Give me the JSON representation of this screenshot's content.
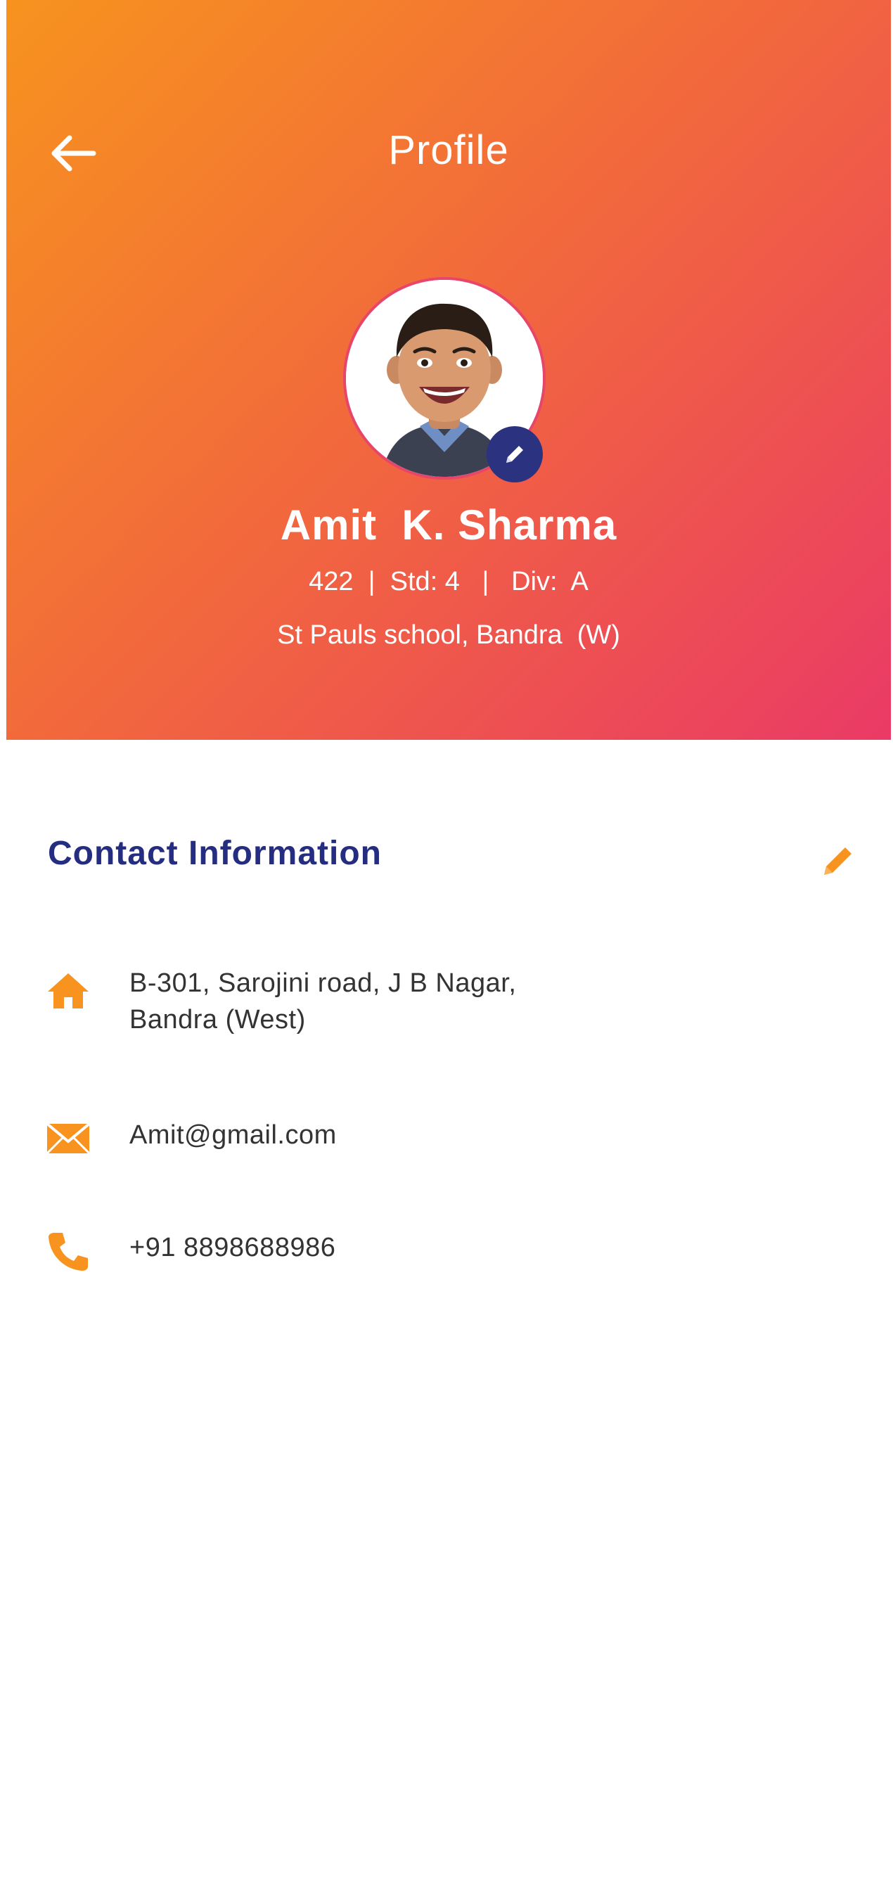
{
  "header": {
    "title": "Profile"
  },
  "profile": {
    "name": "Amit  K. Sharma",
    "meta": "422  |  Std: 4   |   Div:  A",
    "school": "St Pauls school, Bandra  (W)"
  },
  "contact": {
    "section_title": "Contact Information",
    "address_line1": "B-301, Sarojini road, J B Nagar,",
    "address_line2": "Bandra (West)",
    "email": "Amit@gmail.com",
    "phone": "+91 8898688986"
  },
  "icons": {
    "back": "arrow-left-icon",
    "avatar_edit": "pencil-icon",
    "section_edit": "pencil-icon",
    "address": "home-icon",
    "email": "envelope-icon",
    "phone": "phone-icon"
  },
  "colors": {
    "gradient_start": "#f7931e",
    "gradient_end": "#ea3a66",
    "accent_orange": "#f7931e",
    "navy": "#252d80",
    "avatar_edit_bg": "#2b3381"
  }
}
